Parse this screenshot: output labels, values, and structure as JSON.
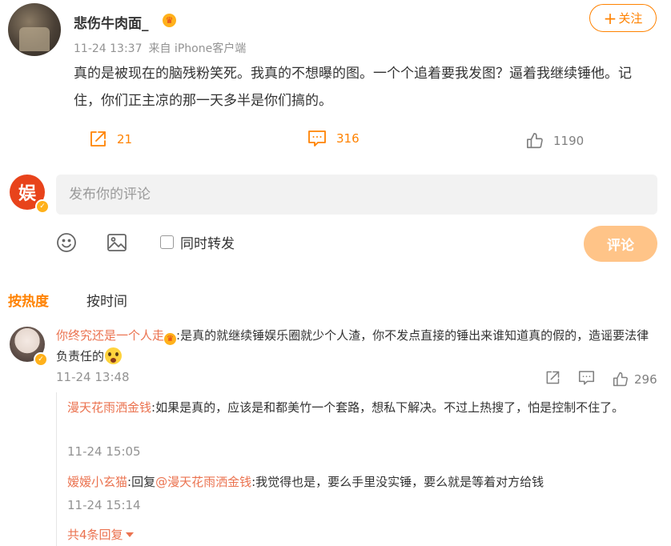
{
  "post": {
    "username": "悲伤牛肉面_",
    "time": "11-24 13:37",
    "source": "来自 iPhone客户端",
    "text": "真的是被现在的脑残粉笑死。我真的不想曝的图。一个个追着要我发图？逼着我继续锤他。记住，你们正主凉的那一天多半是你们搞的。",
    "follow_label": "关注",
    "follow_plus": "+",
    "shares": "21",
    "comments": "316",
    "likes": "1190"
  },
  "composer": {
    "placeholder": "发布你的评论",
    "avatar_char": "娱",
    "forward_label": "同时转发",
    "submit_label": "评论"
  },
  "sort": {
    "hot_label": "按热度",
    "time_label": "按时间"
  },
  "comment": {
    "user": "你终究还是一个人走",
    "text": ":是真的就继续锤娱乐圈就少个人渣，你不发点直接的锤出来谁知道真的假的，造谣要法律负责任的",
    "time": "11-24 13:48",
    "likes": "296"
  },
  "replies": [
    {
      "user": "漫天花雨洒金钱",
      "text": ":如果是真的，应该是和都美竹一个套路，想私下解决。不过上热搜了，怕是控制不住了。",
      "time": "11-24 15:05"
    },
    {
      "user": "嫒嫒小玄猫",
      "reply_prefix": ":回复",
      "mention": "@漫天花雨洒金钱",
      "text": ":我觉得也是，要么手里没实锤，要么就是等着对方给钱",
      "time": "11-24 15:14"
    }
  ],
  "more_replies_label": "共4条回复",
  "colors": {
    "accent": "#ff8200",
    "link": "#eb7350",
    "muted": "#939393",
    "submit_disabled": "#ffc488"
  },
  "icons": [
    "share-icon",
    "comment-icon",
    "like-icon",
    "emoji-icon",
    "image-icon",
    "vip-crown-icon",
    "verified-badge-icon"
  ]
}
